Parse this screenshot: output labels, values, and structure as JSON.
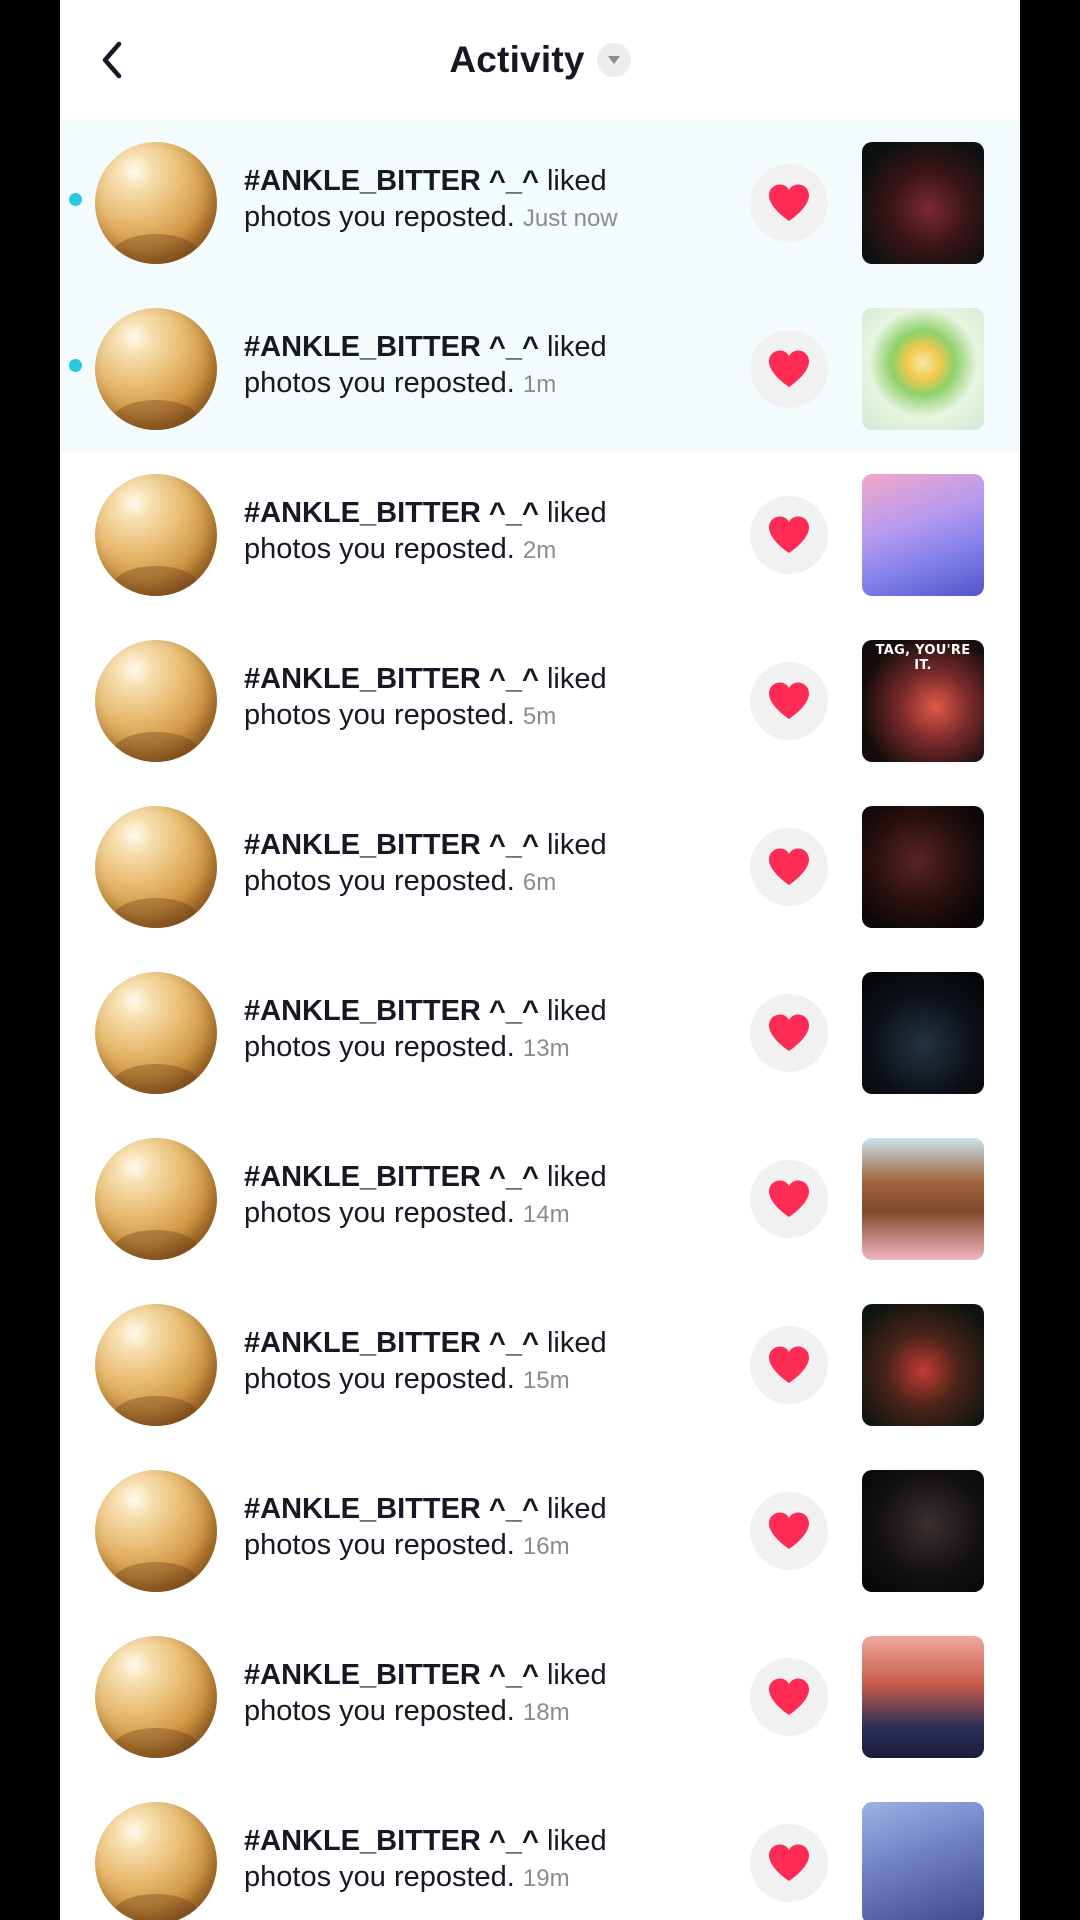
{
  "header": {
    "title": "Activity",
    "back_icon": "chevron-left-icon",
    "dropdown_icon": "caret-down-icon"
  },
  "colors": {
    "like_heart": "#fe2c55",
    "unread_dot": "#2bc7e0",
    "unread_row_bg": "#f3fbfd"
  },
  "notifications": [
    {
      "username": "#ANKLE_BITTER ^_^",
      "action": "liked",
      "message": "photos you reposted.",
      "time": "Just now",
      "unread": true,
      "thumb_caption": ""
    },
    {
      "username": "#ANKLE_BITTER ^_^",
      "action": "liked",
      "message": "photos you reposted.",
      "time": "1m",
      "unread": true,
      "thumb_caption": ""
    },
    {
      "username": "#ANKLE_BITTER ^_^",
      "action": "liked",
      "message": "photos you reposted.",
      "time": "2m",
      "unread": false,
      "thumb_caption": ""
    },
    {
      "username": "#ANKLE_BITTER ^_^",
      "action": "liked",
      "message": "photos you reposted.",
      "time": "5m",
      "unread": false,
      "thumb_caption": "TAG, YOU'RE IT."
    },
    {
      "username": "#ANKLE_BITTER ^_^",
      "action": "liked",
      "message": "photos you reposted.",
      "time": "6m",
      "unread": false,
      "thumb_caption": ""
    },
    {
      "username": "#ANKLE_BITTER ^_^",
      "action": "liked",
      "message": "photos you reposted.",
      "time": "13m",
      "unread": false,
      "thumb_caption": ""
    },
    {
      "username": "#ANKLE_BITTER ^_^",
      "action": "liked",
      "message": "photos you reposted.",
      "time": "14m",
      "unread": false,
      "thumb_caption": ""
    },
    {
      "username": "#ANKLE_BITTER ^_^",
      "action": "liked",
      "message": "photos you reposted.",
      "time": "15m",
      "unread": false,
      "thumb_caption": ""
    },
    {
      "username": "#ANKLE_BITTER ^_^",
      "action": "liked",
      "message": "photos you reposted.",
      "time": "16m",
      "unread": false,
      "thumb_caption": ""
    },
    {
      "username": "#ANKLE_BITTER ^_^",
      "action": "liked",
      "message": "photos you reposted.",
      "time": "18m",
      "unread": false,
      "thumb_caption": ""
    },
    {
      "username": "#ANKLE_BITTER ^_^",
      "action": "liked",
      "message": "photos you reposted.",
      "time": "19m",
      "unread": false,
      "thumb_caption": ""
    }
  ]
}
